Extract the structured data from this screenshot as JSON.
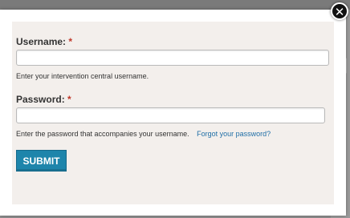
{
  "dialog": {
    "close_icon": "close-icon",
    "close_glyph": "✕",
    "colors": {
      "submit_bg": "#1e85ab",
      "link": "#1f6ea6",
      "required": "#c0392b",
      "panel": "#f3efec"
    }
  },
  "form": {
    "username": {
      "label": "Username:",
      "required_mark": "*",
      "value": "",
      "help": "Enter your intervention central username."
    },
    "password": {
      "label": "Password:",
      "required_mark": "*",
      "value": "",
      "help": "Enter the password that accompanies your username.",
      "forgot_link": "Forgot your password?"
    },
    "submit_label": "SUBMIT"
  }
}
